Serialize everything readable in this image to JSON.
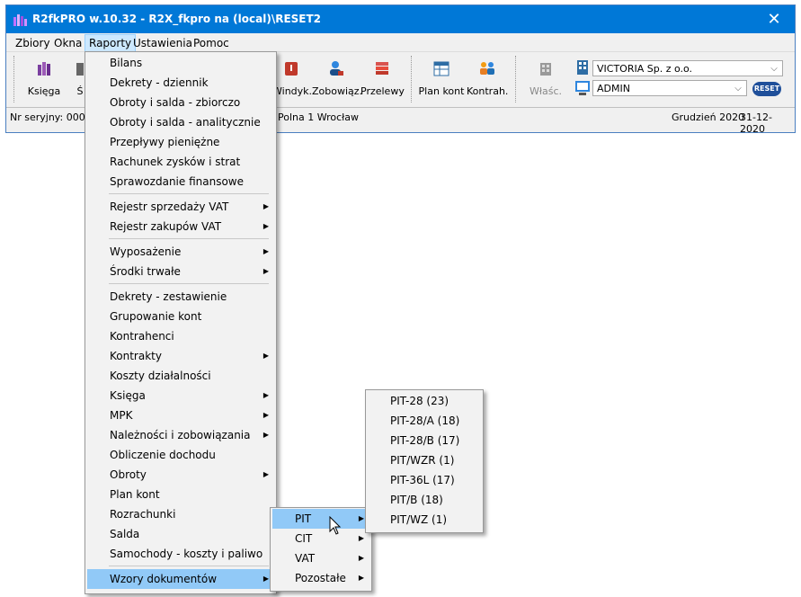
{
  "window": {
    "title": "R2fkPRO w.10.32 - R2X_fkpro na (local)\\RESET2",
    "close_glyph": "✕"
  },
  "menubar": {
    "items": [
      "Zbiory",
      "Okna",
      "Raporty",
      "Ustawienia",
      "Pomoc"
    ],
    "active": "Raporty"
  },
  "toolbar": {
    "buttons": [
      {
        "label": "Księga",
        "icon": "books-icon"
      },
      {
        "label": "Ś",
        "icon": "partial-icon"
      },
      {
        "label": "Windyk.",
        "icon": "collection-icon"
      },
      {
        "label": "Zobowiąz.",
        "icon": "obligations-icon"
      },
      {
        "label": "Przelewy",
        "icon": "transfers-icon"
      },
      {
        "label": "Plan kont",
        "icon": "chart-of-accounts-icon"
      },
      {
        "label": "Kontrah.",
        "icon": "contractors-icon"
      },
      {
        "label": "Właśc.",
        "icon": "owner-icon"
      }
    ],
    "company_combo": "VICTORIA Sp. z o.o.",
    "user_combo": "ADMIN",
    "logo_text": "RESET"
  },
  "statusbar": {
    "serial": "Nr seryjny: 0007",
    "address": "Polna 1 Wrocław",
    "period": "Grudzień 2020",
    "date": "31-12-2020"
  },
  "raporty_menu": {
    "items": [
      "Bilans",
      "Dekrety - dziennik",
      "Obroty i salda - zbiorczo",
      "Obroty i salda - analitycznie",
      "Przepływy pieniężne",
      "Rachunek zysków i strat",
      "Sprawozdanie finansowe",
      "Rejestr sprzedaży VAT",
      "Rejestr zakupów VAT",
      "Wyposażenie",
      "Środki trwałe",
      "Dekrety - zestawienie",
      "Grupowanie kont",
      "Kontrahenci",
      "Kontrakty",
      "Koszty działalności",
      "Księga",
      "MPK",
      "Należności i zobowiązania",
      "Obliczenie dochodu",
      "Obroty",
      "Plan kont",
      "Rozrachunki",
      "Salda",
      "Samochody - koszty i paliwo",
      "Wzory dokumentów"
    ]
  },
  "wzory_menu": {
    "items": [
      "PIT",
      "CIT",
      "VAT",
      "Pozostałe"
    ]
  },
  "pit_menu": {
    "items": [
      "PIT-28 (23)",
      "PIT-28/A (18)",
      "PIT-28/B (17)",
      "PIT/WZR (1)",
      "PIT-36L (17)",
      "PIT/B (18)",
      "PIT/WZ (1)"
    ]
  },
  "colors": {
    "titlebar": "#0078d7",
    "menu_highlight": "#91c9f7",
    "active_menu": "#cce8ff"
  }
}
